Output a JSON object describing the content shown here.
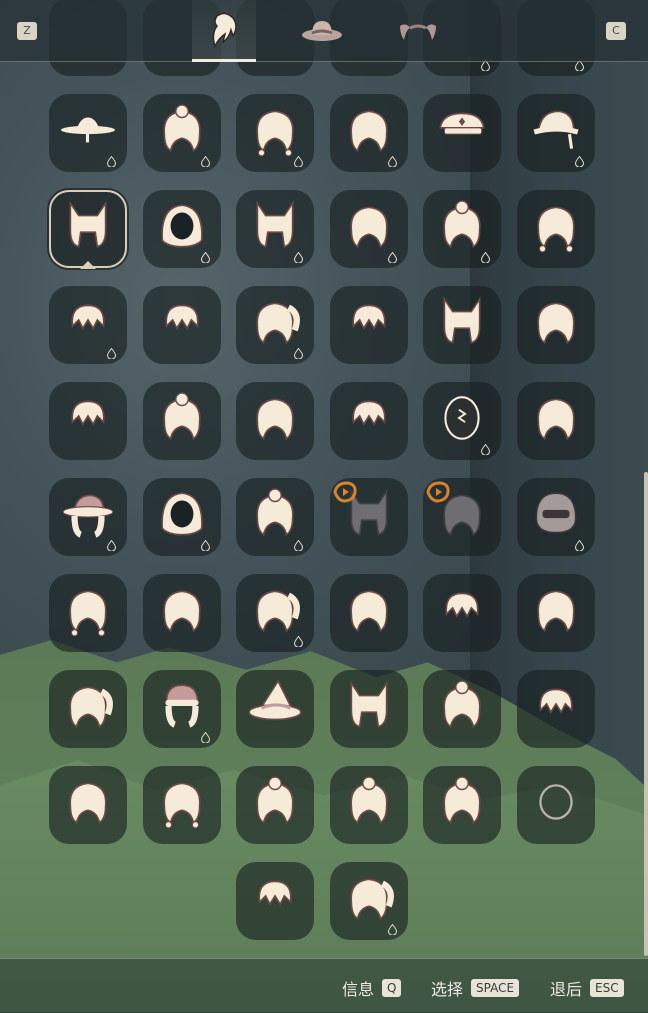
{
  "header": {
    "left_key": "Z",
    "right_key": "C",
    "tabs": [
      {
        "name": "hair-tab",
        "icon": "hair-icon",
        "active": true
      },
      {
        "name": "hat-tab",
        "icon": "hat-icon",
        "active": false
      },
      {
        "name": "horns-tab",
        "icon": "horns-icon",
        "active": false
      }
    ]
  },
  "grid": {
    "columns": 6,
    "items": [
      {
        "icon": "bowl-hat-icon",
        "drop": true
      },
      {
        "icon": "flower-bun-hair-icon",
        "drop": true
      },
      {
        "icon": "braided-twin-hair-icon",
        "drop": true
      },
      {
        "icon": "wavy-long-hair-icon",
        "drop": true
      },
      {
        "icon": "cap-hat-icon",
        "drop": false
      },
      {
        "icon": "bucket-hat-icon",
        "drop": true
      },
      {
        "icon": "cat-ears-hair-icon",
        "drop": false,
        "selected": true
      },
      {
        "icon": "hood-icon",
        "drop": true
      },
      {
        "icon": "animal-ear-hair-icon",
        "drop": true
      },
      {
        "icon": "bob-hood-hair-icon",
        "drop": true
      },
      {
        "icon": "twin-buns-hair-icon",
        "drop": true
      },
      {
        "icon": "side-braid-hair-icon",
        "drop": false
      },
      {
        "icon": "spiky-headband-hair-icon",
        "drop": true
      },
      {
        "icon": "short-messy-hair-icon",
        "drop": false
      },
      {
        "icon": "ponytail-hair-icon",
        "drop": true
      },
      {
        "icon": "tuft-hair-icon",
        "drop": false
      },
      {
        "icon": "bunny-ear-hair-icon",
        "drop": false
      },
      {
        "icon": "bowl-cut-hair-icon",
        "drop": false
      },
      {
        "icon": "curl-top-hair-icon",
        "drop": false
      },
      {
        "icon": "high-bun-hair-icon",
        "drop": false
      },
      {
        "icon": "sprout-hair-icon",
        "drop": false
      },
      {
        "icon": "fluffy-short-hair-icon",
        "drop": false
      },
      {
        "icon": "egg-icon",
        "drop": true
      },
      {
        "icon": "wide-bob-hair-icon",
        "drop": false
      },
      {
        "icon": "flower-hat-icon",
        "drop": true
      },
      {
        "icon": "hood-icon",
        "drop": true
      },
      {
        "icon": "bun-scrunchie-hair-icon",
        "drop": true
      },
      {
        "icon": "cat-ear-long-hair-icon",
        "drop": false,
        "locked": true
      },
      {
        "icon": "long-bob-hair-icon",
        "drop": false,
        "locked": true
      },
      {
        "icon": "helmet-icon",
        "drop": true
      },
      {
        "icon": "pigtails-hair-icon",
        "drop": false
      },
      {
        "icon": "bonnet-hair-icon",
        "drop": false
      },
      {
        "icon": "long-side-hair-icon",
        "drop": true
      },
      {
        "icon": "scarf-long-hair-icon",
        "drop": false
      },
      {
        "icon": "curly-bob-hair-icon",
        "drop": false
      },
      {
        "icon": "bow-hair-icon",
        "drop": false
      },
      {
        "icon": "side-swept-hair-icon",
        "drop": false
      },
      {
        "icon": "beanie-hair-icon",
        "drop": true
      },
      {
        "icon": "witch-hat-icon",
        "drop": false
      },
      {
        "icon": "fox-ears-hair-icon",
        "drop": false
      },
      {
        "icon": "tiara-hair-icon",
        "drop": false
      },
      {
        "icon": "wild-curly-hair-icon",
        "drop": false
      },
      {
        "icon": "feather-hair-icon",
        "drop": false
      },
      {
        "icon": "braided-pigtails-hair-icon",
        "drop": false
      },
      {
        "icon": "swirl-bun-hair-icon",
        "drop": false
      },
      {
        "icon": "swirl-curls-hair-icon",
        "drop": false
      },
      {
        "icon": "flower-bob-hair-icon",
        "drop": false
      },
      {
        "icon": "bald-icon",
        "drop": false
      },
      {
        "icon": "hood-curls-hair-icon",
        "drop": false,
        "col": 2
      },
      {
        "icon": "messy-ponytail-hair-icon",
        "drop": true,
        "col": 3
      }
    ]
  },
  "footer": {
    "info_label": "信息",
    "info_key": "Q",
    "select_label": "选择",
    "select_key": "SPACE",
    "back_label": "退后",
    "back_key": "ESC"
  },
  "colors": {
    "icon_fill": "#f6ead8",
    "icon_stroke": "#6b4a45",
    "accent_pink": "#c49a9a",
    "locked_gray": "#6e6e72",
    "lock_orange": "#d8822a"
  }
}
